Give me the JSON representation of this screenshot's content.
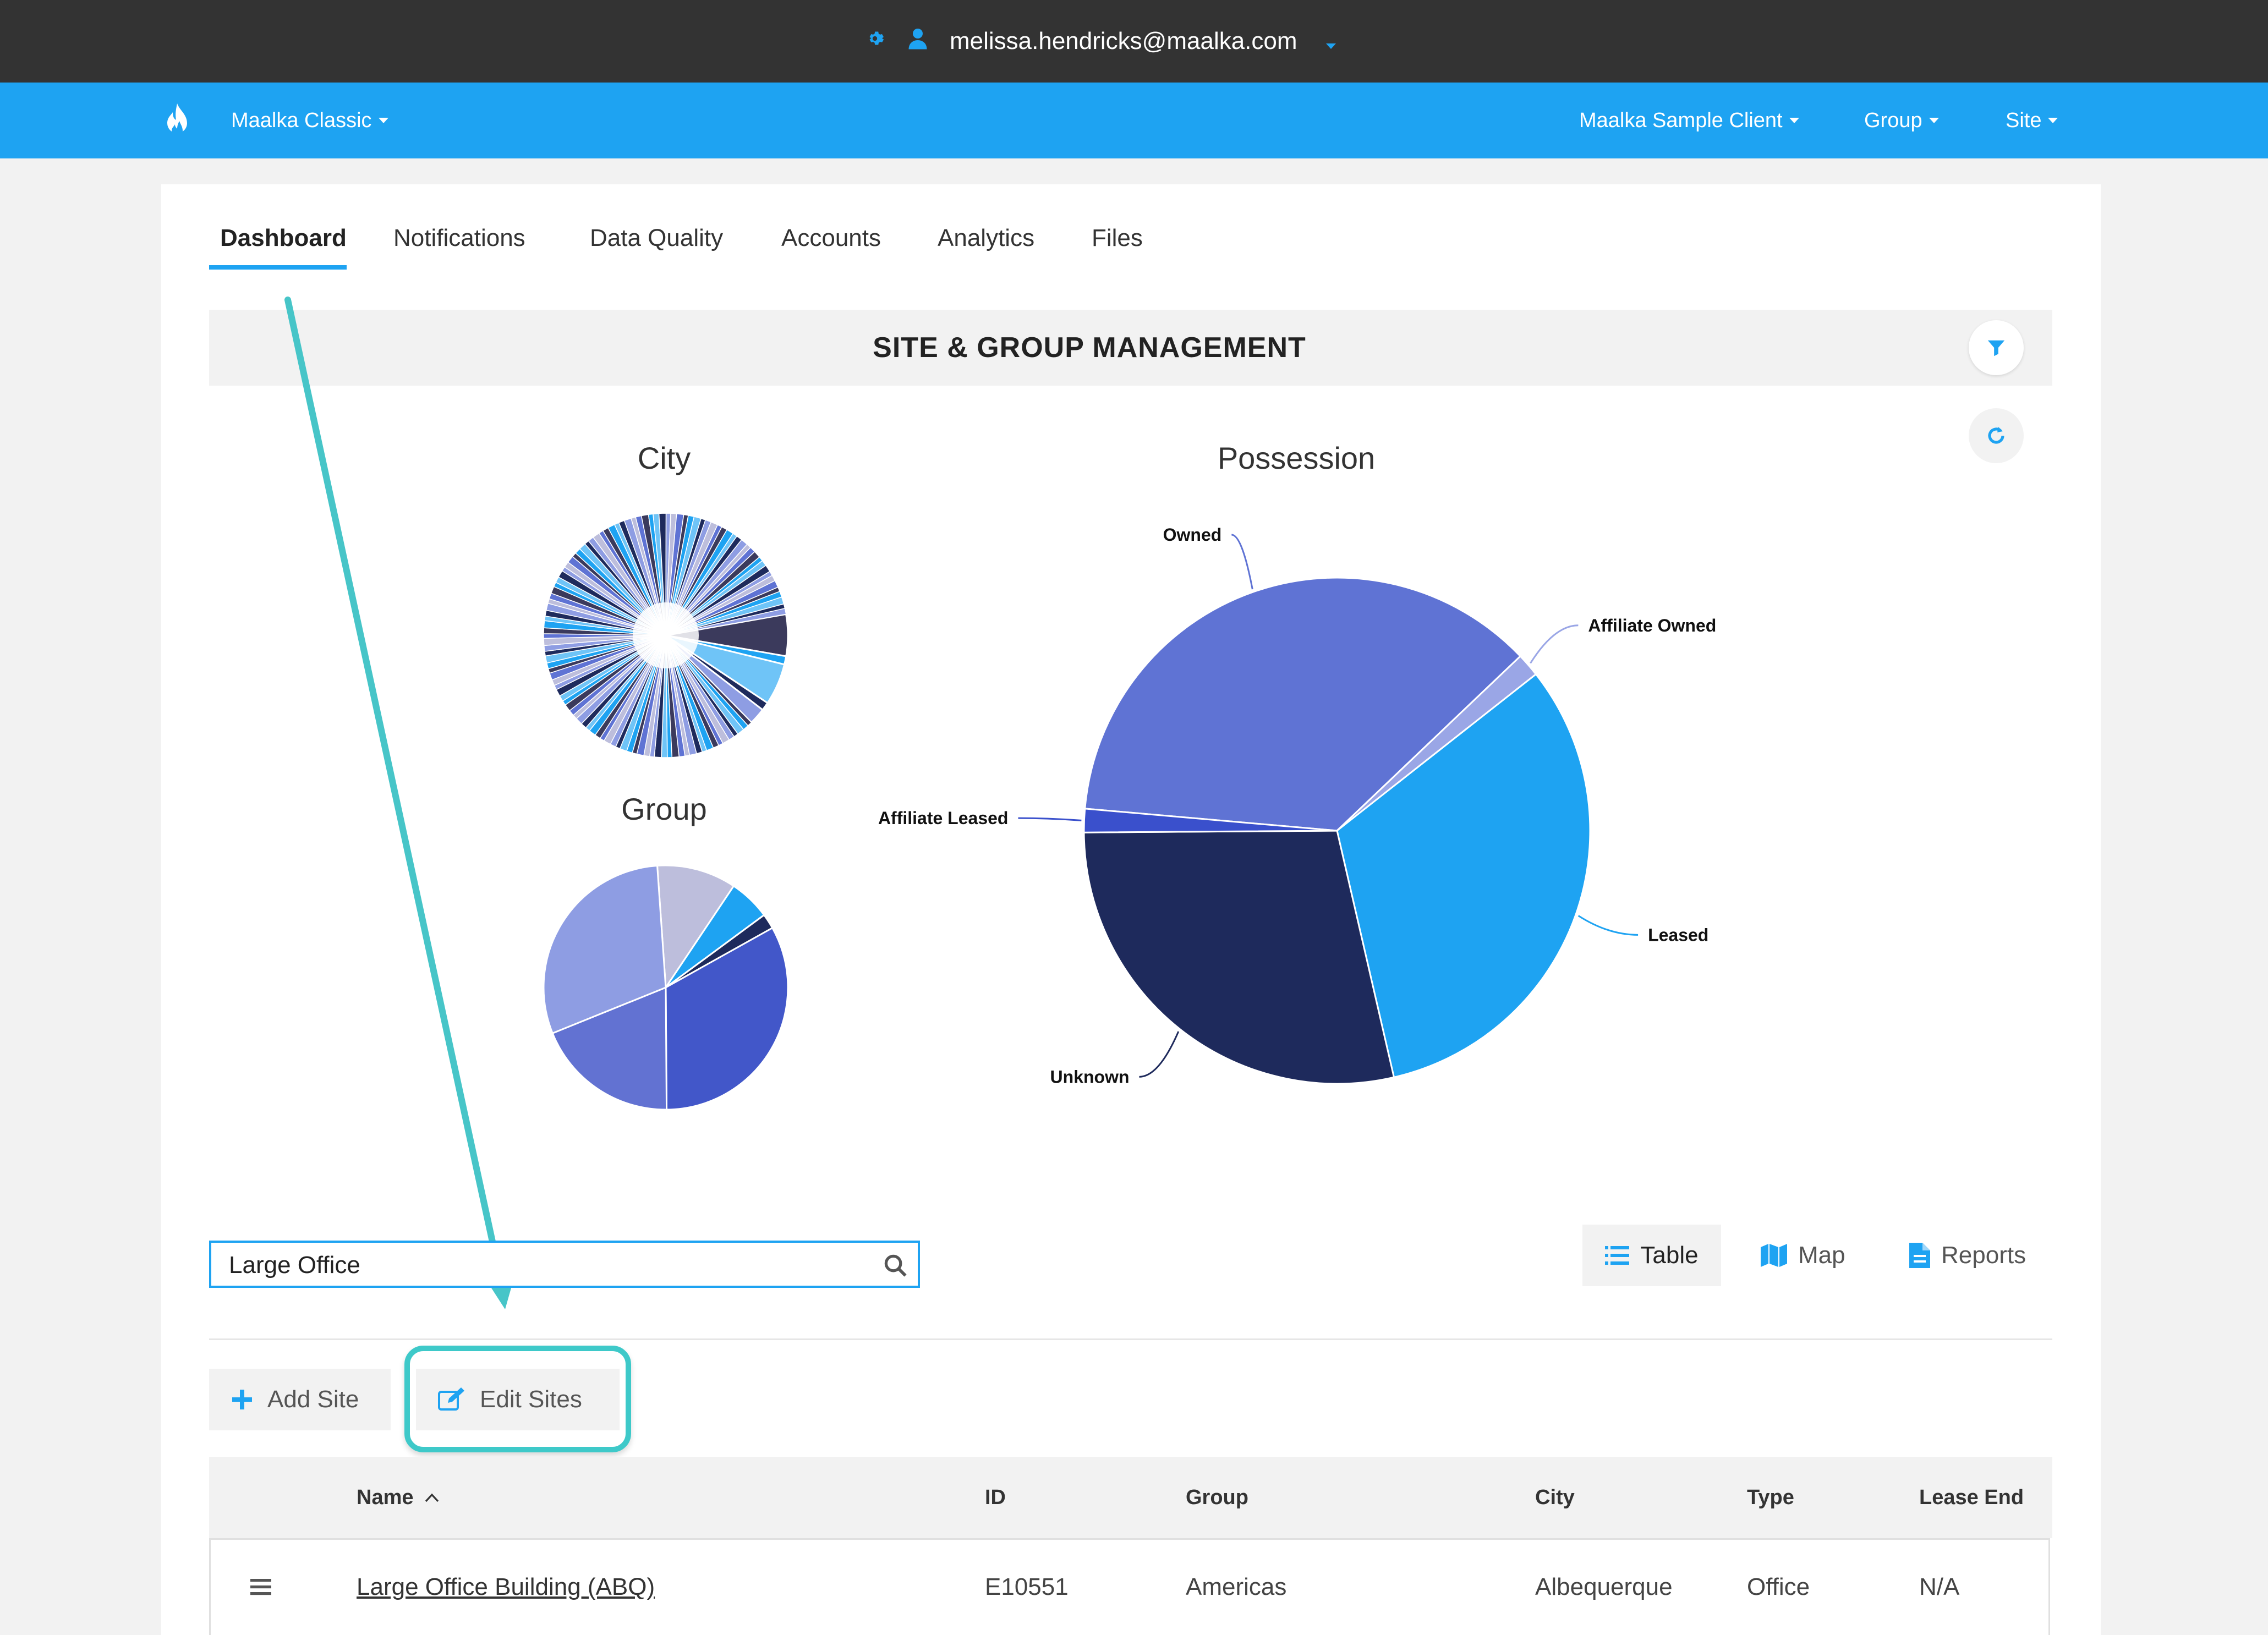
{
  "topbar": {
    "user_email": "melissa.hendricks@maalka.com",
    "icons": [
      "gear-icon",
      "user-icon",
      "caret-down-icon"
    ]
  },
  "navbar": {
    "brand": "Maalka Classic",
    "client": "Maalka Sample Client",
    "group": "Group",
    "site": "Site"
  },
  "tabs": [
    "Dashboard",
    "Notifications",
    "Data Quality",
    "Accounts",
    "Analytics",
    "Files"
  ],
  "header": {
    "title": "SITE & GROUP MANAGEMENT"
  },
  "charts": {
    "city_title": "City",
    "group_title": "Group",
    "possession_title": "Possession"
  },
  "chart_data": [
    {
      "type": "pie",
      "title": "Possession",
      "categories": [
        "Owned",
        "Affiliate Owned",
        "Leased",
        "Unknown",
        "Affiliate Leased"
      ],
      "values": [
        36.5,
        1.5,
        32.0,
        28.5,
        1.5
      ],
      "colors": [
        "#5f73d4",
        "#9aa6e6",
        "#1ea3f2",
        "#1e2a5c",
        "#3a50cc"
      ]
    },
    {
      "type": "pie",
      "title": "Group",
      "values": [
        10.5,
        5.5,
        2,
        33,
        19,
        30
      ],
      "colors": [
        "#bdbedc",
        "#1ea3f2",
        "#1e2a5c",
        "#4257c9",
        "#6272d2",
        "#8e9de3"
      ]
    },
    {
      "type": "pie",
      "title": "City",
      "note_values_unlabeled": true,
      "colors": [
        "#3b3a5c",
        "#1ea3f2",
        "#6fc4f7",
        "#1e2a5c",
        "#8e9de3",
        "#bdbedc",
        "#5f73d4"
      ]
    }
  ],
  "search": {
    "value": "Large Office",
    "icon": "search-icon"
  },
  "views": {
    "table": "Table",
    "map": "Map",
    "reports": "Reports"
  },
  "actions": {
    "add_site": "Add Site",
    "edit_sites": "Edit Sites"
  },
  "table": {
    "columns": {
      "name": "Name",
      "id": "ID",
      "group": "Group",
      "city": "City",
      "type": "Type",
      "lease_end": "Lease End"
    },
    "rows": [
      {
        "name": "Large Office Building (ABQ)",
        "id": "E10551",
        "group": "Americas",
        "city": "Albequerque",
        "type": "Office",
        "lease_end": "N/A"
      }
    ]
  }
}
